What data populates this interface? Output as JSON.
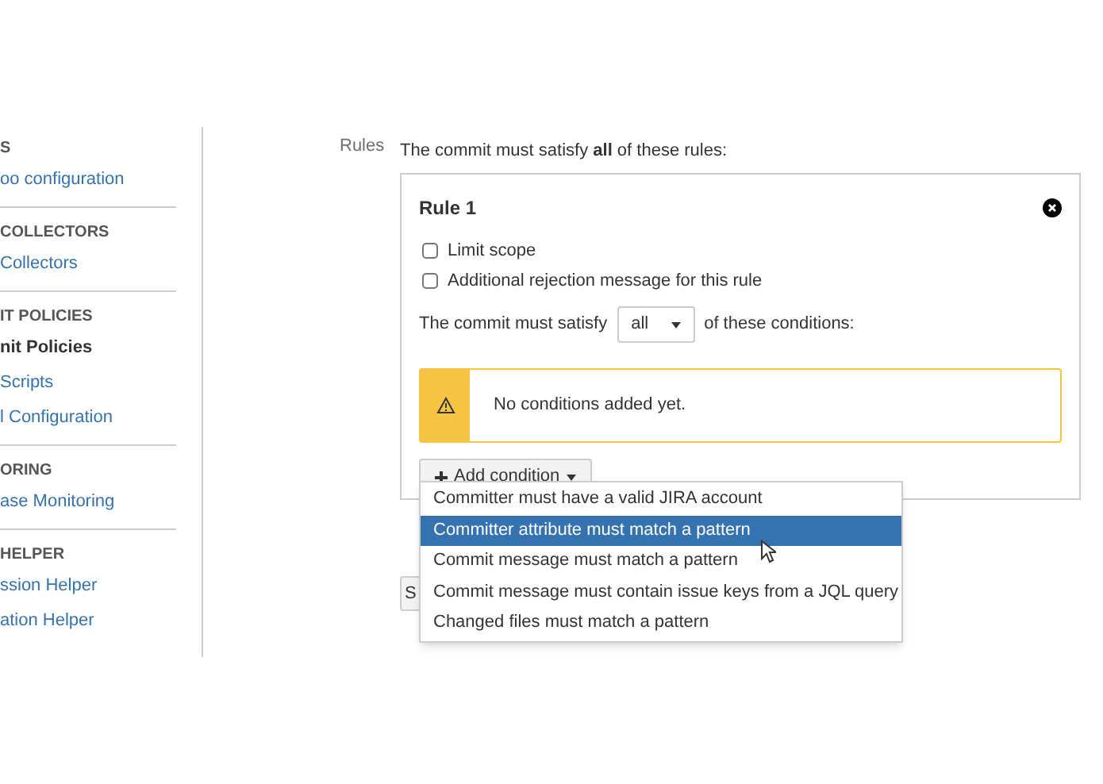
{
  "sidebar": {
    "sections": [
      {
        "heading": "S",
        "items": [
          {
            "label": "oo configuration",
            "selected": false
          }
        ]
      },
      {
        "heading": "COLLECTORS",
        "items": [
          {
            "label": "Collectors",
            "selected": false
          }
        ]
      },
      {
        "heading": "IT POLICIES",
        "items": [
          {
            "label": "nit Policies",
            "selected": true
          },
          {
            "label": "Scripts",
            "selected": false
          },
          {
            "label": "l Configuration",
            "selected": false
          }
        ]
      },
      {
        "heading": "ORING",
        "items": [
          {
            "label": "ase Monitoring",
            "selected": false
          }
        ]
      },
      {
        "heading": "HELPER",
        "items": [
          {
            "label": "ssion Helper",
            "selected": false
          },
          {
            "label": "ation Helper",
            "selected": false
          }
        ]
      }
    ]
  },
  "rules": {
    "label": "Rules",
    "intro": "The commit must satisfy **all** of these rules:",
    "rule": {
      "title": "Rule 1",
      "options": [
        {
          "label": "Limit scope",
          "checked": false
        },
        {
          "label": "Additional rejection message for this rule",
          "checked": false
        }
      ],
      "condition_prefix": "The commit must satisfy",
      "condition_select": "all",
      "condition_suffix": "of these conditions:",
      "warning": "No conditions added yet.",
      "add_button": "Add condition",
      "menu": [
        {
          "label": "Committer must have a valid JIRA account",
          "selected": false
        },
        {
          "label": "Committer attribute must match a pattern",
          "selected": true
        },
        {
          "label": "Commit message must match a pattern",
          "selected": false
        },
        {
          "label": "Commit message must contain issue keys from a JQL query",
          "selected": false
        },
        {
          "label": "Changed files must match a pattern",
          "selected": false
        }
      ]
    },
    "save_button": "S"
  }
}
